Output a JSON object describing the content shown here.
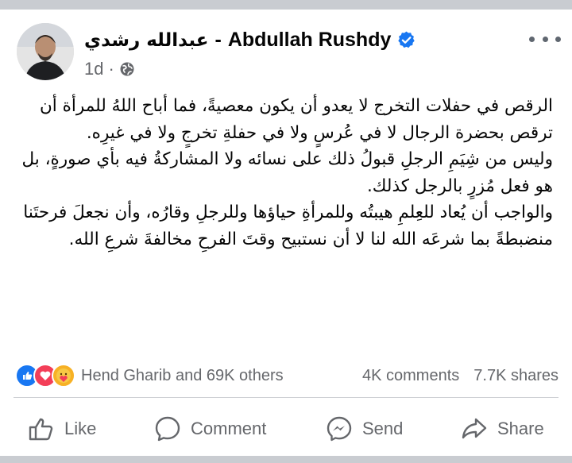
{
  "post": {
    "author": {
      "name_ar": "عبدالله رشدي",
      "separator": "-",
      "name_en": "Abdullah Rushdy"
    },
    "time": "1d",
    "meta_dot": "·",
    "body": [
      "الرقص في حفلات التخرج لا يعدو أن يكون معصيةً، فما أباح اللهُ للمرأة أن ترقص بحضرة الرجال لا في عُرسٍ ولا في حفلةِ تخرجٍ ولا في غيرِه.",
      "وليس من شِيَمِ الرجلِ قبولُ ذلك على نسائه ولا المشاركةُ فيه بأي صورةٍ، بل هو فعل مُزرٍ بالرجل كذلك.",
      "والواجب أن يُعاد للعِلمِ هيبتُه وللمرأةِ حياؤها وللرجلِ وقارُه، وأن نجعلَ فرحتَنا منضبطةً بما شرعَه الله لنا لا أن نستبيح وقتَ الفرحِ مخالفةَ شرعِ الله."
    ]
  },
  "engagement": {
    "likers": "Hend Gharib and 69K others",
    "comments": "4K comments",
    "shares": "7.7K shares",
    "reaction_colors": {
      "like": "#1877f2",
      "love": "#f33e58",
      "care": "#f7b125"
    }
  },
  "actions": {
    "like": "Like",
    "comment": "Comment",
    "send": "Send",
    "share": "Share"
  },
  "colors": {
    "text": "#050505",
    "secondary": "#65676b",
    "verified": "#1877f2",
    "divider": "#ced0d4"
  }
}
